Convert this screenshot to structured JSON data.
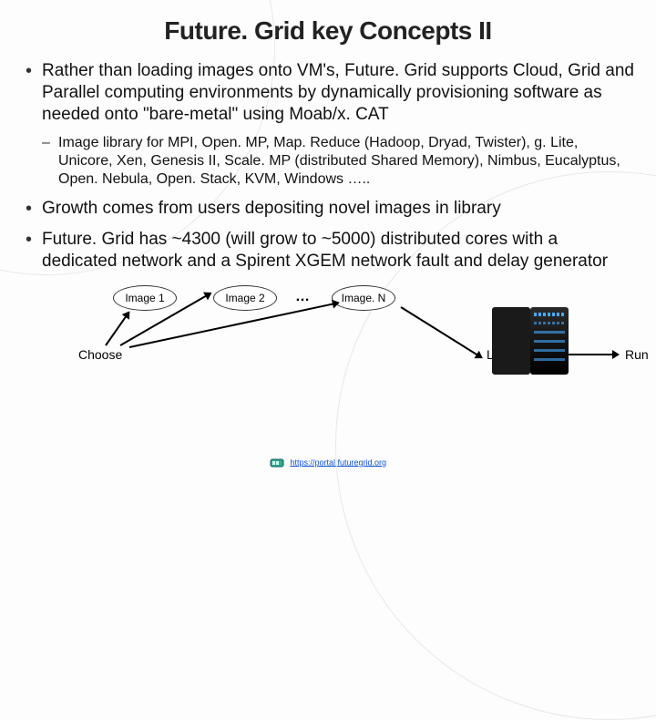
{
  "title": "Future. Grid key Concepts II",
  "bullets": {
    "b1": "Rather than loading images onto VM's, Future. Grid supports Cloud, Grid and Parallel computing environments by dynamically provisioning software as needed onto \"bare-metal\" using Moab/x. CAT",
    "sub1": "Image library for MPI, Open. MP, Map. Reduce (Hadoop, Dryad, Twister), g. Lite, Unicore, Xen, Genesis II, Scale. MP (distributed Shared Memory), Nimbus, Eucalyptus, Open. Nebula, Open. Stack, KVM, Windows …..",
    "b2": "Growth comes from users depositing novel images in library",
    "b3": "Future. Grid has ~4300 (will grow to ~5000) distributed cores with a dedicated network and a Spirent XGEM network fault and delay generator"
  },
  "diagram": {
    "image1": "Image 1",
    "image2": "Image 2",
    "ellipsis": "…",
    "imageN": "Image. N",
    "choose": "Choose",
    "load": "Load",
    "run": "Run"
  },
  "footer": {
    "url": "https://portal.futuregrid.org"
  }
}
